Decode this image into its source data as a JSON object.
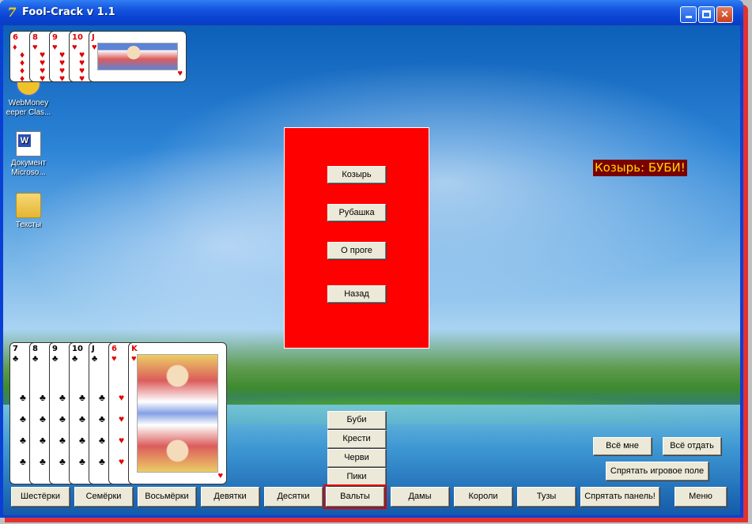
{
  "window": {
    "title": "Fool-Crack v 1.1"
  },
  "desktop_icons": [
    {
      "name": "webmoney-icon",
      "label_line1": "WebMoney",
      "label_line2": "eeper Clas..."
    },
    {
      "name": "word-doc-icon",
      "label_line1": "Документ",
      "label_line2": "Microso..."
    },
    {
      "name": "folder-icon",
      "label_line1": "Тексты",
      "label_line2": ""
    }
  ],
  "menu_panel": {
    "trump_button": "Козырь",
    "back_design_button": "Рубашка",
    "about_button": "О проге",
    "back_button": "Назад"
  },
  "trump_label": "Козырь: БУБИ!",
  "top_hand": [
    {
      "rank": "6",
      "suit": "♦",
      "color": "#e00000"
    },
    {
      "rank": "8",
      "suit": "♥",
      "color": "#e00000"
    },
    {
      "rank": "9",
      "suit": "♥",
      "color": "#e00000"
    },
    {
      "rank": "10",
      "suit": "♥",
      "color": "#e00000"
    },
    {
      "rank": "J",
      "suit": "♥",
      "color": "#e00000",
      "face": "jack"
    }
  ],
  "bottom_hand": [
    {
      "rank": "7",
      "suit": "♣",
      "color": "#000000"
    },
    {
      "rank": "8",
      "suit": "♣",
      "color": "#000000"
    },
    {
      "rank": "9",
      "suit": "♣",
      "color": "#000000"
    },
    {
      "rank": "10",
      "suit": "♣",
      "color": "#000000"
    },
    {
      "rank": "J",
      "suit": "♣",
      "color": "#000000"
    },
    {
      "rank": "6",
      "suit": "♥",
      "color": "#e00000"
    },
    {
      "rank": "K",
      "suit": "♥",
      "color": "#e00000",
      "face": "king"
    }
  ],
  "suit_buttons": [
    "Буби",
    "Крести",
    "Черви",
    "Пики"
  ],
  "right_controls": {
    "all_to_me": "Всё мне",
    "give_all": "Всё отдать",
    "hide_field": "Спрятать игровое поле"
  },
  "bottom_bar": {
    "ranks": [
      "Шестёрки",
      "Семёрки",
      "Восьмёрки",
      "Девятки",
      "Десятки",
      "Вальты",
      "Дамы",
      "Короли",
      "Тузы"
    ],
    "selected_index": 5,
    "hide_panel": "Спрятать панель!",
    "menu": "Меню"
  },
  "colors": {
    "panel": "#ff0000",
    "trump_bg": "#7a0000",
    "trump_text": "#ffd800",
    "accent_selected": "#e00000"
  }
}
